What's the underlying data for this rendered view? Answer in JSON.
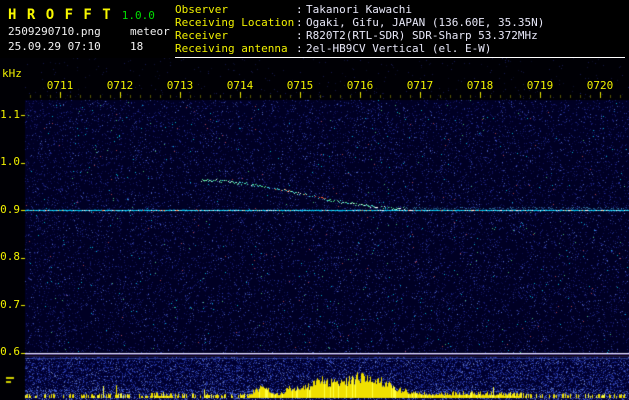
{
  "app": {
    "title": "H R O F F T",
    "version": "1.0.0",
    "filename": "2509290710.png",
    "mode": "meteor",
    "datetime": "25.09.29 07:10",
    "count": "18"
  },
  "info": {
    "colon": ":",
    "rows": [
      {
        "label": "Observer",
        "value": "Takanori Kawachi"
      },
      {
        "label": "Receiving Location",
        "value": "Ogaki, Gifu, JAPAN (136.60E, 35.35N)"
      },
      {
        "label": "Receiver",
        "value": "R820T2(RTL-SDR) SDR-Sharp 53.372MHz"
      },
      {
        "label": "Receiving antenna",
        "value": "2el-HB9CV Vertical (el. E-W)"
      }
    ]
  },
  "chart_data": {
    "type": "heatmap",
    "title": "HROFFT radio meteor observation spectrogram, 10-minute frame 0710-0720",
    "x_axis": {
      "labels": [
        "0711",
        "0712",
        "0713",
        "0714",
        "0715",
        "0716",
        "0717",
        "0718",
        "0719",
        "0720"
      ],
      "unit": "time (hhmm)",
      "minutes_per_division": 1
    },
    "y_axis": {
      "unit": "kHz",
      "ticks": [
        "1.1",
        "1.0",
        "0.9",
        "0.8",
        "0.7",
        "0.6"
      ],
      "range_khz": [
        0.55,
        1.15
      ]
    },
    "features": {
      "carrier_line_khz": 0.9,
      "separator_line_khz": 0.6,
      "trace": {
        "start_min": 3.35,
        "start_khz": 0.962,
        "end_min": 6.75,
        "end_khz": 0.903,
        "description": "slowly descending doppler trace (green/red/cyan dots) merging into the 0.9 kHz carrier line near 0716, faint continuation to right edge"
      },
      "bursts": [
        {
          "center_min": 6.03,
          "width_min": 0.43,
          "level": 1.0
        },
        {
          "center_min": 5.3,
          "width_min": 0.17,
          "level": 0.6
        },
        {
          "center_min": 4.88,
          "width_min": 0.12,
          "level": 0.4
        },
        {
          "center_min": 4.38,
          "width_min": 0.13,
          "level": 0.45
        },
        {
          "center_min": 7.83,
          "width_min": 0.67,
          "level": 0.14
        },
        {
          "center_min": 2.67,
          "width_min": 0.42,
          "level": 0.07
        }
      ],
      "solid_burst_range_min": [
        5.63,
        6.53
      ]
    },
    "colors": {
      "background": "#000000",
      "field_background": "#000024",
      "noise_blue": "#2a2a96",
      "carrier_cyan": "#00c8f0",
      "trace_green": "#50e890",
      "trace_red": "#ff6040",
      "burst_yellow": "#f0e000",
      "separator_white": "#e8e8ff",
      "axis_yellow": "#f0f000",
      "version_green": "#00dc00",
      "text_white": "#e8e8f8"
    }
  }
}
